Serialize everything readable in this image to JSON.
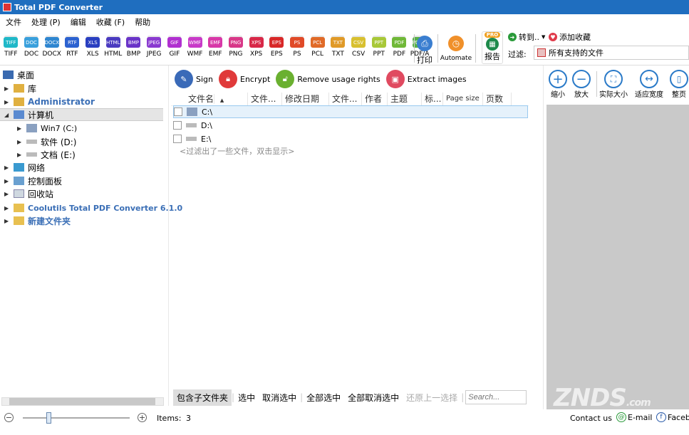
{
  "title": "Total PDF Converter",
  "menu": [
    "文件",
    "处理 (P)",
    "编辑",
    "收藏 (F)",
    "帮助"
  ],
  "formats": [
    {
      "label": "TIFF",
      "color": "#20b8c8"
    },
    {
      "label": "DOC",
      "color": "#3aa0dc"
    },
    {
      "label": "DOCX",
      "color": "#2f86d0"
    },
    {
      "label": "RTF",
      "color": "#2c62d0"
    },
    {
      "label": "XLS",
      "color": "#2a3fc0"
    },
    {
      "label": "HTML",
      "color": "#4a3ac0"
    },
    {
      "label": "BMP",
      "color": "#6a34c8"
    },
    {
      "label": "JPEG",
      "color": "#8a3ad0"
    },
    {
      "label": "GIF",
      "color": "#b030d0"
    },
    {
      "label": "WMF",
      "color": "#c83ac8"
    },
    {
      "label": "EMF",
      "color": "#d838a8"
    },
    {
      "label": "PNG",
      "color": "#d83888"
    },
    {
      "label": "XPS",
      "color": "#d82848"
    },
    {
      "label": "EPS",
      "color": "#d82828"
    },
    {
      "label": "PS",
      "color": "#e04a28"
    },
    {
      "label": "PCL",
      "color": "#e06a28"
    },
    {
      "label": "TXT",
      "color": "#e09a28"
    },
    {
      "label": "CSV",
      "color": "#d8c030"
    },
    {
      "label": "PPT",
      "color": "#a8c838"
    },
    {
      "label": "PDF",
      "color": "#70b838"
    },
    {
      "label": "PDF/A",
      "color": "#58b048"
    }
  ],
  "toolbar": {
    "print": "打印",
    "automate": "Automate",
    "report": "报告",
    "pro_badge": "PRO",
    "goto": "转到..",
    "add_favorite": "添加收藏",
    "filter_label": "过滤:",
    "filter_value": "所有支持的文件"
  },
  "tree": [
    {
      "label": "桌面"
    },
    {
      "label": "库"
    },
    {
      "label": "Administrator"
    },
    {
      "label": "计算机"
    },
    {
      "label": "Win7 (C:)"
    },
    {
      "label": "软件 (D:)"
    },
    {
      "label": "文档 (E:)"
    },
    {
      "label": "网络"
    },
    {
      "label": "控制面板"
    },
    {
      "label": "回收站"
    },
    {
      "label": "Coolutils Total PDF Converter 6.1.0"
    },
    {
      "label": "新建文件夹"
    }
  ],
  "actions": {
    "sign": "Sign",
    "encrypt": "Encrypt",
    "remove_rights": "Remove usage rights",
    "extract_images": "Extract images"
  },
  "columns": [
    "文件名",
    "文件...",
    "修改日期",
    "文件...",
    "作者",
    "主题",
    "标...",
    "Page size",
    "页数"
  ],
  "files": [
    "C:\\",
    "D:\\",
    "E:\\"
  ],
  "filter_note": "<过滤出了一些文件，双击显示>",
  "bottom": {
    "include_subfolders": "包含子文件夹",
    "select": "选中",
    "deselect": "取消选中",
    "select_all": "全部选中",
    "deselect_all": "全部取消选中",
    "restore": "还原上一选择",
    "search_placeholder": "Search..."
  },
  "viewer": {
    "zoom_out": "缩小",
    "zoom_in": "放大",
    "actual_size": "实际大小",
    "fit_width": "适应宽度",
    "full_page": "整页"
  },
  "status": {
    "items_label": "Items:",
    "items_count": "3",
    "contact": "Contact us",
    "email": "E-mail",
    "facebook": "Faceb"
  },
  "watermark": "ZNDS.com"
}
